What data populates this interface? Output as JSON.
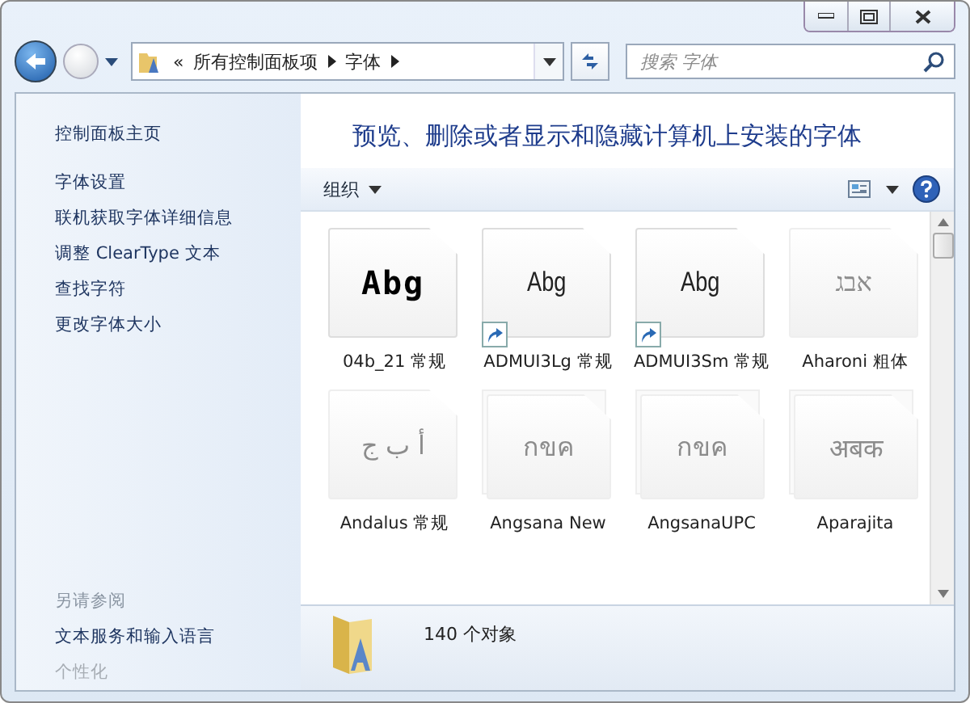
{
  "address_bar": {
    "overflow": "«",
    "crumbs": [
      "所有控制面板项",
      "字体"
    ]
  },
  "search": {
    "placeholder": "搜索 字体"
  },
  "sidebar": {
    "items": [
      {
        "label": "控制面板主页",
        "kind": "home"
      },
      {
        "label": "字体设置",
        "kind": "link"
      },
      {
        "label": "联机获取字体详细信息",
        "kind": "link"
      },
      {
        "label": "调整 ClearType 文本",
        "kind": "link"
      },
      {
        "label": "查找字符",
        "kind": "link"
      },
      {
        "label": "更改字体大小",
        "kind": "link"
      }
    ],
    "see_also": {
      "heading": "另请参阅",
      "links": [
        {
          "label": "文本服务和输入语言",
          "disabled": false
        },
        {
          "label": "个性化",
          "disabled": true
        }
      ]
    }
  },
  "heading": "预览、删除或者显示和隐藏计算机上安装的字体",
  "toolbar": {
    "organize": "组织"
  },
  "fonts": [
    {
      "name": "04b_21 常规",
      "preview": "Abg",
      "kind": "pixel",
      "stacked": false,
      "shortcut": false,
      "hidden": false
    },
    {
      "name": "ADMUI3Lg 常规",
      "preview": "Abg",
      "kind": "narrow",
      "stacked": false,
      "shortcut": true,
      "hidden": false
    },
    {
      "name": "ADMUI3Sm 常规",
      "preview": "Abg",
      "kind": "narrow",
      "stacked": false,
      "shortcut": true,
      "hidden": false
    },
    {
      "name": "Aharoni 粗体",
      "preview": "אבג",
      "kind": "serif",
      "stacked": false,
      "shortcut": false,
      "hidden": true
    },
    {
      "name": "Andalus 常规",
      "preview": "أ ب ج",
      "kind": "serif",
      "stacked": false,
      "shortcut": false,
      "hidden": true
    },
    {
      "name": "Angsana New",
      "preview": "กขค",
      "kind": "serif",
      "stacked": true,
      "shortcut": false,
      "hidden": true
    },
    {
      "name": "AngsanaUPC",
      "preview": "กขค",
      "kind": "serif",
      "stacked": true,
      "shortcut": false,
      "hidden": true
    },
    {
      "name": "Aparajita",
      "preview": "अबक",
      "kind": "serif",
      "stacked": true,
      "shortcut": false,
      "hidden": true
    }
  ],
  "status_bar": {
    "count": "140 个对象"
  }
}
